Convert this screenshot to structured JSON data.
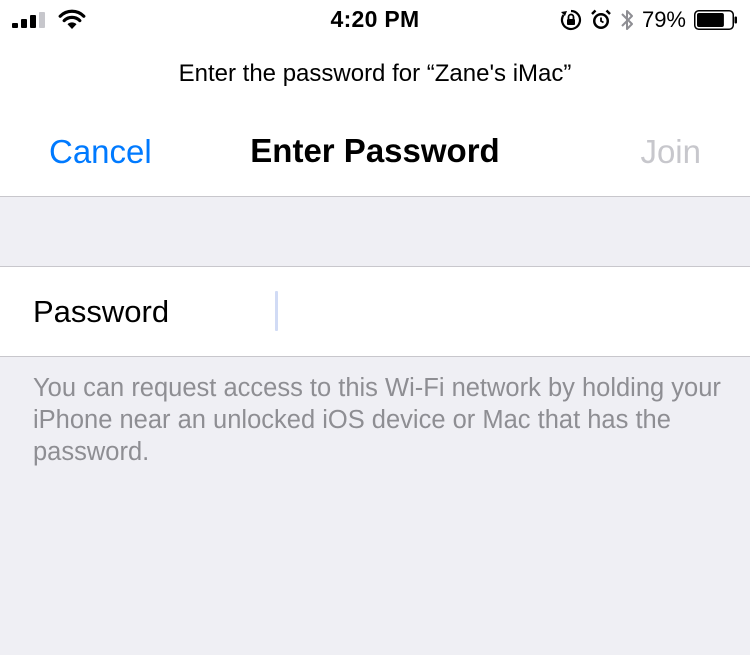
{
  "status_bar": {
    "time": "4:20 PM",
    "battery_percent": "79%",
    "battery_level": 0.79,
    "signal_bars": 3,
    "signal_total": 4,
    "icons": [
      "signal-icon",
      "wifi-icon",
      "orientation-lock-icon",
      "alarm-icon",
      "bluetooth-icon",
      "battery-icon"
    ]
  },
  "prompt": "Enter the password for “Zane's iMac”",
  "nav": {
    "cancel": "Cancel",
    "title": "Enter Password",
    "join": "Join"
  },
  "password_field": {
    "label": "Password",
    "value": ""
  },
  "footer_note": "You can request access to this Wi-Fi network by holding your iPhone near an unlocked iOS device or Mac that has the password.",
  "colors": {
    "accent": "#007aff",
    "disabled": "#c7c7cc",
    "background": "#efeff4",
    "secondary_text": "#8e8e93"
  }
}
